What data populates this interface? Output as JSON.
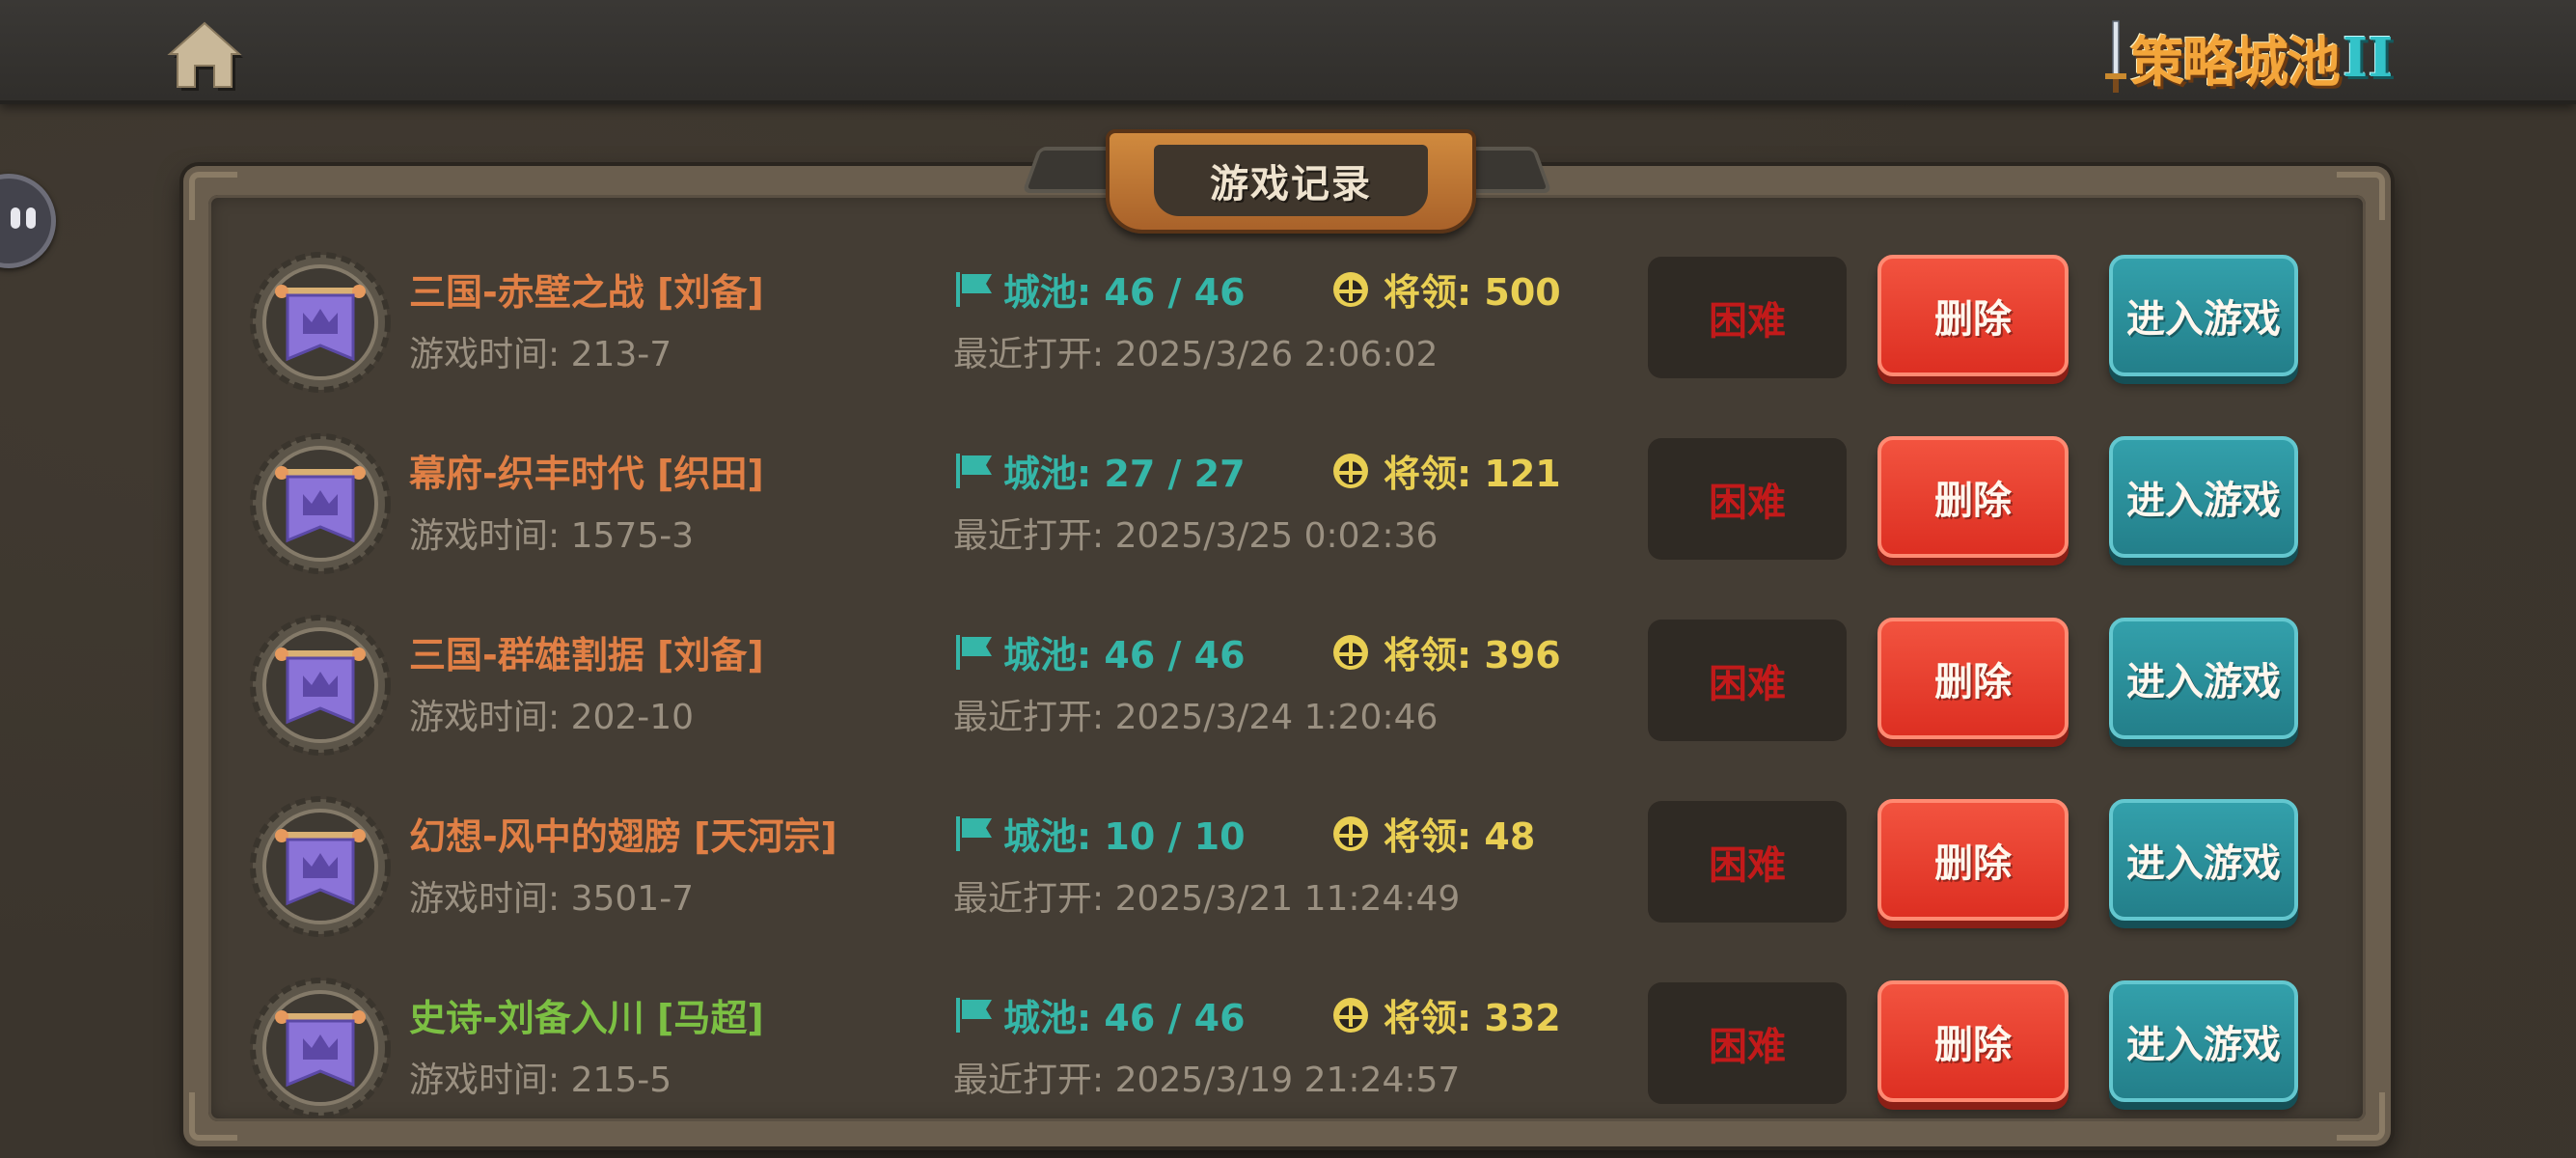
{
  "header": {
    "home_icon": "home-icon",
    "logo_text": "策略城池",
    "logo_numeral": "II"
  },
  "panel": {
    "title": "游戏记录"
  },
  "records": [
    {
      "title": "三国-赤壁之战 [刘备]",
      "title_color": "#e07f45",
      "game_time": "游戏时间: 213-7",
      "cities": "城池: 46 / 46",
      "generals": "将领: 500",
      "last_opened": "最近打开: 2025/3/26 2:06:02",
      "difficulty": "困难",
      "delete_label": "删除",
      "enter_label": "进入游戏"
    },
    {
      "title": "幕府-织丰时代 [织田]",
      "title_color": "#e07f45",
      "game_time": "游戏时间: 1575-3",
      "cities": "城池: 27 / 27",
      "generals": "将领: 121",
      "last_opened": "最近打开: 2025/3/25 0:02:36",
      "difficulty": "困难",
      "delete_label": "删除",
      "enter_label": "进入游戏"
    },
    {
      "title": "三国-群雄割据 [刘备]",
      "title_color": "#e07f45",
      "game_time": "游戏时间: 202-10",
      "cities": "城池: 46 / 46",
      "generals": "将领: 396",
      "last_opened": "最近打开: 2025/3/24 1:20:46",
      "difficulty": "困难",
      "delete_label": "删除",
      "enter_label": "进入游戏"
    },
    {
      "title": "幻想-风中的翅膀 [天河宗]",
      "title_color": "#e07f45",
      "game_time": "游戏时间: 3501-7",
      "cities": "城池: 10 / 10",
      "generals": "将领: 48",
      "last_opened": "最近打开: 2025/3/21 11:24:49",
      "difficulty": "困难",
      "delete_label": "删除",
      "enter_label": "进入游戏"
    },
    {
      "title": "史诗-刘备入川 [马超]",
      "title_color": "#7cc043",
      "game_time": "游戏时间: 215-5",
      "cities": "城池: 46 / 46",
      "generals": "将领: 332",
      "last_opened": "最近打开: 2025/3/19 21:24:57",
      "difficulty": "困难",
      "delete_label": "删除",
      "enter_label": "进入游戏"
    }
  ]
}
